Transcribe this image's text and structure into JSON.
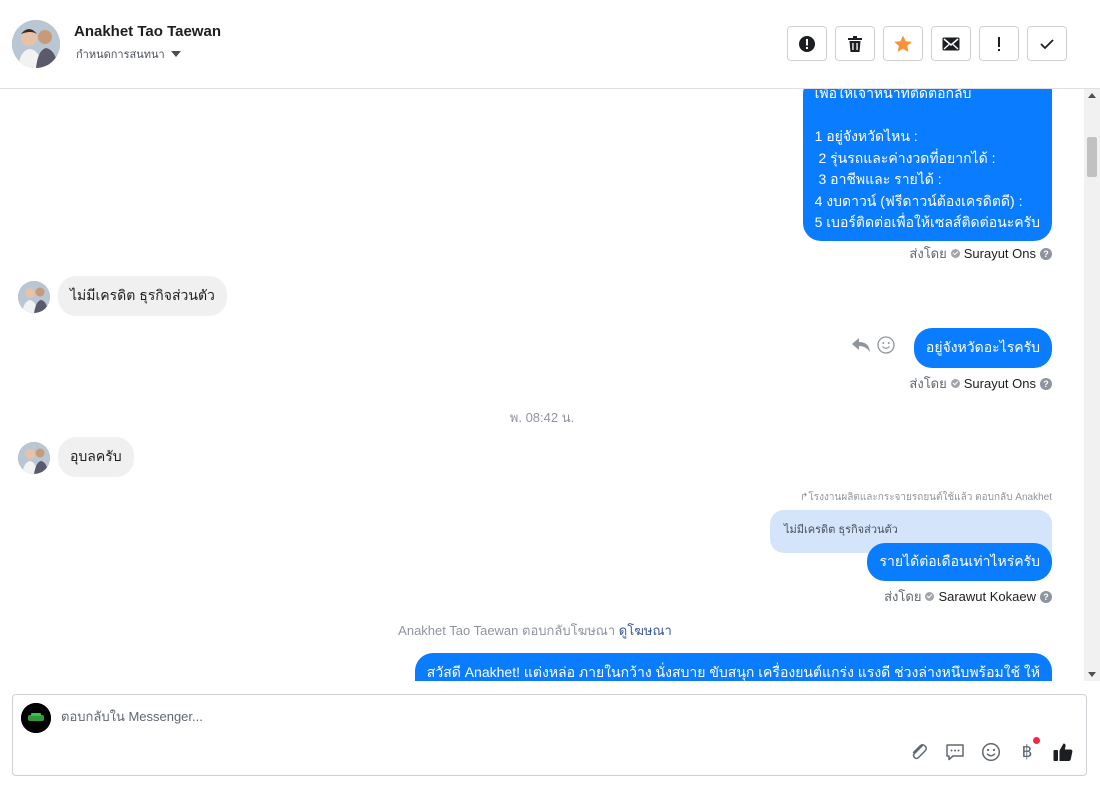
{
  "header": {
    "contact_name": "Anakhet Tao Taewan",
    "assign_label": "กำหนดการสนทนา",
    "toolbar": [
      {
        "icon": "alert-circle-icon",
        "name": "spam-button"
      },
      {
        "icon": "trash-icon",
        "name": "delete-button"
      },
      {
        "icon": "star-icon",
        "name": "star-button"
      },
      {
        "icon": "envelope-icon",
        "name": "mark-unread-button"
      },
      {
        "icon": "exclamation-icon",
        "name": "follow-up-button"
      },
      {
        "icon": "checkmark-icon",
        "name": "mark-done-button"
      }
    ],
    "star_color": "#f7923a"
  },
  "messages": {
    "m1": "เพื่อให้เจ้าหน้าที่ติดต่อกลับ\n\n1 อยู่จังหวัดไหน :\n 2 รุ่นรถและค่างวดที่อยากได้ :\n 3 อาชีพและ รายได้ :\n4 งบดาวน์ (ฟรีดาวน์ต้องเครดิตดี) :\n5 เบอร์ติดต่อเพื่อให้เซลส์ติดต่อนะครับ",
    "m1_sent_label": "ส่งโดย",
    "m1_sender": "Surayut Ons",
    "m2": "ไม่มีเครดิต ธุรกิจส่วนตัว",
    "m3": "อยู่จังหวัดอะไรครับ",
    "m3_sent_label": "ส่งโดย",
    "m3_sender": "Surayut Ons",
    "timestamp": "พ. 08:42 น.",
    "m4": "อุบลครับ",
    "reply_note": "↱โรงงานผลิตและกระจายรถยนต์ใช้แล้ว ตอบกลับ Anakhet",
    "quoted": "ไม่มีเครดิต ธุรกิจส่วนตัว",
    "m5": "รายได้ต่อเดือนเท่าไหร่ครับ",
    "m5_sent_label": "ส่งโดย",
    "m5_sender": "Sarawut Kokaew",
    "ad_note_text": "Anakhet Tao Taewan ตอบกลับโฆษณา",
    "ad_link": "ดูโฆษณา",
    "m6": "สวัสดี Anakhet! แต่งหล่อ ภายในกว้าง นั่งสบาย ขับสนุก เครื่องยนต์แกร่ง แรงดี ช่วงล่างหนึบพร้อมใช้ ให้"
  },
  "composer": {
    "placeholder": "ตอบกลับใน Messenger...",
    "icons": [
      "paperclip-icon",
      "saved-reply-icon",
      "emoji-icon",
      "baht-payment-icon",
      "thumbs-up-icon"
    ],
    "baht_symbol": "฿"
  },
  "colors": {
    "outgoing_bubble": "#0a7cff",
    "incoming_bubble": "#f0f0f0",
    "quoted_bubble": "#d4e4fb",
    "notification_dot": "#f02849"
  }
}
